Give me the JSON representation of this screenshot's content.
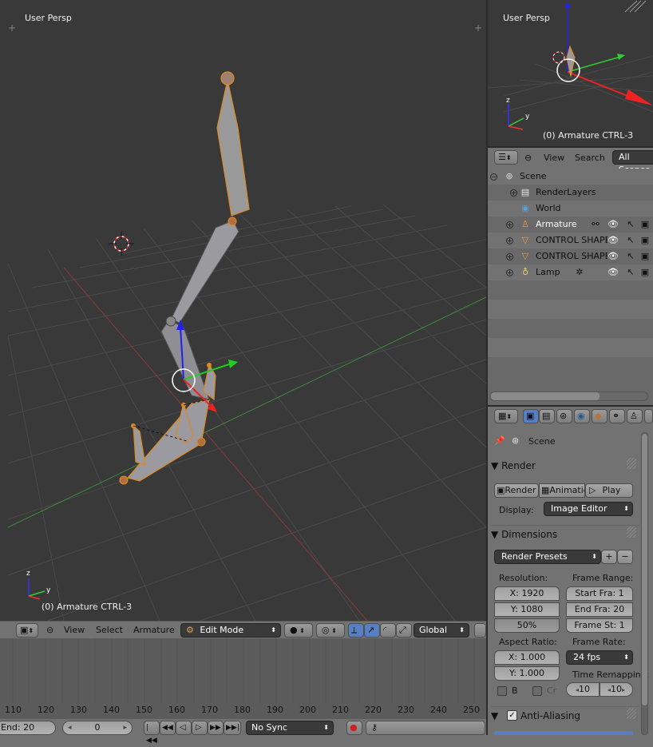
{
  "viewport_main": {
    "view_label": "User Persp",
    "object_label": "(0) Armature CTRL-3"
  },
  "header_3d": {
    "menus": [
      "View",
      "Select",
      "Armature"
    ],
    "mode": "Edit Mode",
    "orientation": "Global"
  },
  "timeline": {
    "ruler": [
      "110",
      "120",
      "130",
      "140",
      "150",
      "160",
      "170",
      "180",
      "190",
      "200",
      "210",
      "220",
      "230",
      "240",
      "250"
    ],
    "end_field": "End: 20",
    "current_frame": "0",
    "sync": "No Sync"
  },
  "viewport_mini": {
    "view_label": "User Persp",
    "object_label": "(0) Armature CTRL-3"
  },
  "outliner": {
    "menu_view": "View",
    "menu_search": "Search",
    "filter": "All Scenes",
    "rows": [
      {
        "label": "Scene"
      },
      {
        "label": "RenderLayers"
      },
      {
        "label": "World"
      },
      {
        "label": "Armature"
      },
      {
        "label": "CONTROL SHAPES"
      },
      {
        "label": "CONTROL SHAPES"
      },
      {
        "label": "Lamp"
      }
    ]
  },
  "properties": {
    "context": "Scene",
    "render_panel": {
      "title": "Render",
      "render_btn": "Render",
      "animation_btn": "Animation",
      "play_btn": "Play",
      "display_label": "Display:",
      "display_value": "Image Editor"
    },
    "dimensions_panel": {
      "title": "Dimensions",
      "presets": "Render Presets",
      "resolution_label": "Resolution:",
      "res_x": "X: 1920",
      "res_y": "Y: 1080",
      "res_pct": "50%",
      "frame_range_label": "Frame Range:",
      "start": "Start Fra: 1",
      "end": "End Fra: 20",
      "step": "Frame St: 1",
      "aspect_label": "Aspect Ratio:",
      "aspect_x": "X: 1.000",
      "aspect_y": "Y: 1.000",
      "frame_rate_label": "Frame Rate:",
      "fps": "24 fps",
      "time_remap_label": "Time Remapping:",
      "border_label": "B",
      "crop_label": "Cr",
      "remap_old": "10",
      "remap_new": "10"
    },
    "aa_panel": {
      "title": "Anti-Aliasing"
    }
  }
}
